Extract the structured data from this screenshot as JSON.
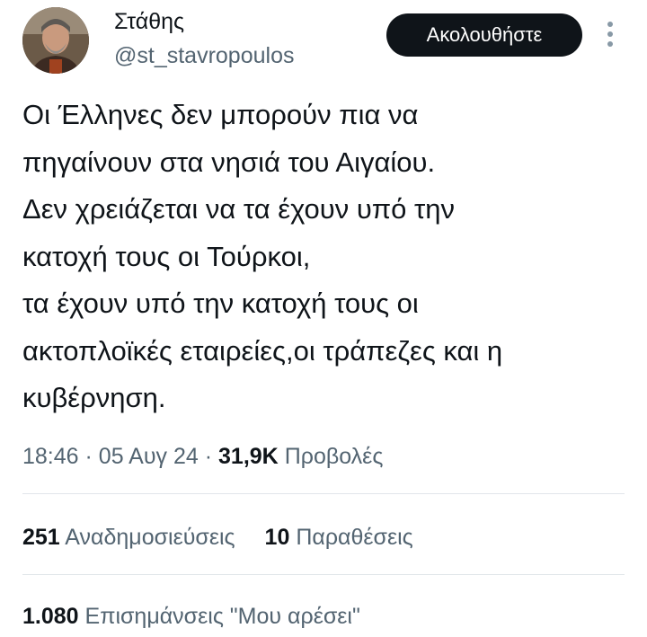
{
  "author": {
    "name": "Στάθης",
    "handle": "@st_stavropoulos",
    "follow_label": "Ακολουθήστε"
  },
  "tweet": {
    "text": "Οι Έλληνες δεν μπορούν πια να\nπηγαίνουν στα νησιά του Αιγαίου.\nΔεν χρειάζεται να τα έχουν υπό την\nκατοχή τους οι Τούρκοι,\nτα έχουν υπό την κατοχή τους οι\nακτοπλοϊκές εταιρείες,οι τράπεζες και η\nκυβέρνηση.",
    "time": "18:46",
    "date": "05 Αυγ 24",
    "views_count": "31,9K",
    "views_label": "Προβολές"
  },
  "stats": {
    "reposts_count": "251",
    "reposts_label": "Αναδημοσιεύσεις",
    "quotes_count": "10",
    "quotes_label": "Παραθέσεις",
    "likes_count": "1.080",
    "likes_label": "Επισημάνσεις \"Μου αρέσει\""
  },
  "colors": {
    "text": "#0f1419",
    "secondary": "#536471",
    "button_bg": "#0f1419",
    "divider": "#e1e6ea"
  },
  "icons": {
    "more": "more-vertical-icon"
  }
}
